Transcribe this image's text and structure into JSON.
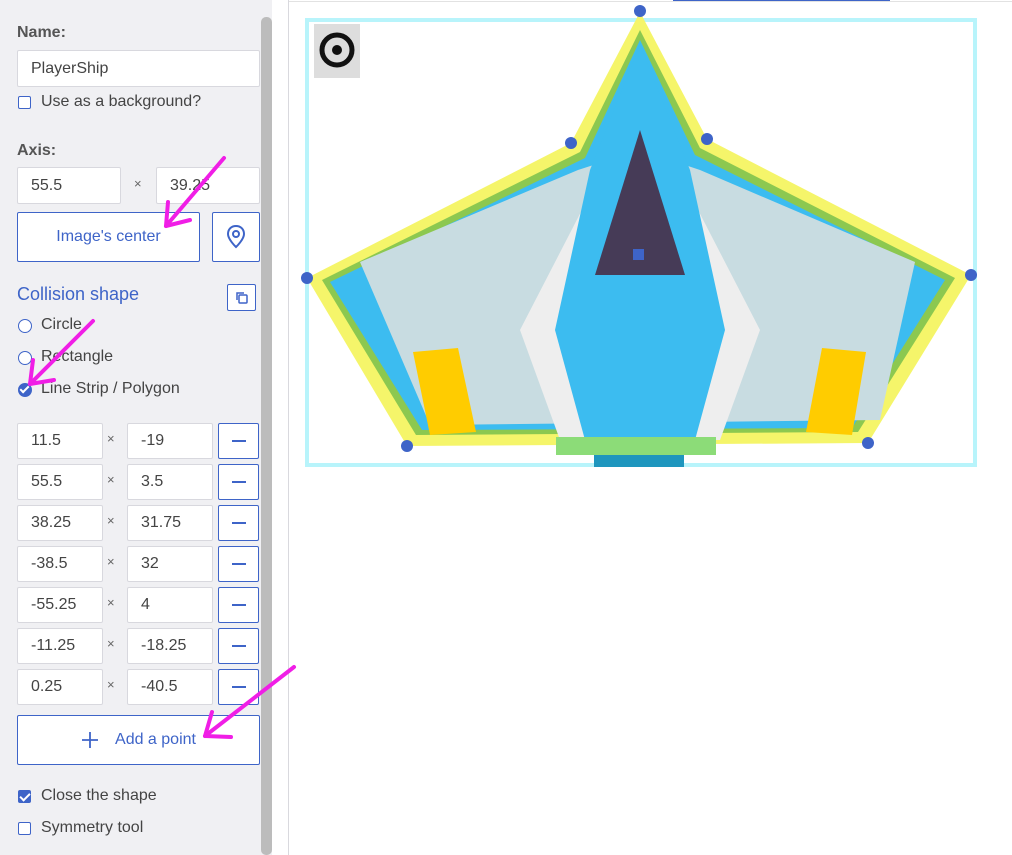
{
  "name_section": {
    "label": "Name:",
    "value": "PlayerShip",
    "background_label": "Use as a background?",
    "background_checked": false
  },
  "axis": {
    "label": "Axis:",
    "x": "55.5",
    "y": "39.25",
    "separator": "×",
    "center_button": "Image's center",
    "pick_icon": "map-pin-icon"
  },
  "collision": {
    "title": "Collision shape",
    "copy_icon": "copy-icon",
    "options": [
      {
        "label": "Circle",
        "selected": false
      },
      {
        "label": "Rectangle",
        "selected": false
      },
      {
        "label": "Line Strip / Polygon",
        "selected": true
      }
    ],
    "points": [
      {
        "x": "11.5",
        "y": "-19"
      },
      {
        "x": "55.5",
        "y": "3.5"
      },
      {
        "x": "38.25",
        "y": "31.75"
      },
      {
        "x": "-38.5",
        "y": "32"
      },
      {
        "x": "-55.25",
        "y": "4"
      },
      {
        "x": "-11.25",
        "y": "-18.25"
      },
      {
        "x": "0.25",
        "y": "-40.5"
      }
    ],
    "add_point": "Add a point",
    "close_shape": {
      "label": "Close the shape",
      "checked": true
    },
    "symmetry": {
      "label": "Symmetry tool",
      "checked": false
    }
  },
  "colors": {
    "accent": "#3e64c8",
    "annotation_arrow": "#f01ee6",
    "ship_blue": "#3cbcf0",
    "ship_dark": "#463b57",
    "ship_yellow": "#ffcc00",
    "outline_yellow": "#f5f56a",
    "frame_cyan": "#b8f4fb"
  }
}
